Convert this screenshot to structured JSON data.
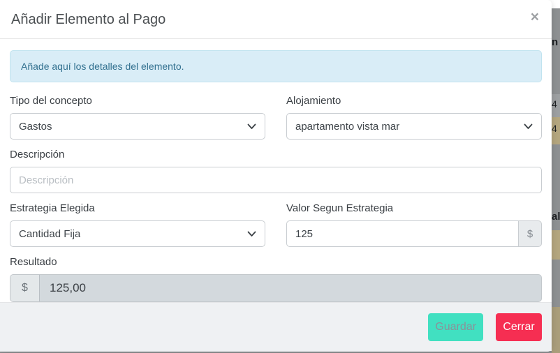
{
  "modal": {
    "title": "Añadir Elemento al Pago",
    "close_icon": "×",
    "alert_text": "Añade aquí los detalles del elemento.",
    "fields": {
      "tipo_concepto": {
        "label": "Tipo del concepto",
        "value": "Gastos"
      },
      "alojamiento": {
        "label": "Alojamiento",
        "value": "apartamento vista mar"
      },
      "descripcion": {
        "label": "Descripción",
        "placeholder": "Descripción",
        "value": ""
      },
      "estrategia": {
        "label": "Estrategia Elegida",
        "value": "Cantidad Fija"
      },
      "valor": {
        "label": "Valor Segun Estrategia",
        "value": "125",
        "addon": "$"
      },
      "resultado": {
        "label": "Resultado",
        "addon": "$",
        "value": "125,00"
      }
    },
    "buttons": {
      "save": "Guardar",
      "close": "Cerrar"
    }
  },
  "colors": {
    "alert_bg": "#d9edf7",
    "alert_text": "#31708f",
    "save_bg": "#41e0c1",
    "save_text": "#8a9299",
    "close_bg": "#f62e52",
    "close_text": "#ffffff"
  },
  "background": {
    "fragments": {
      "f1": "n",
      "f2": "4",
      "f3": "4",
      "f4": "al"
    }
  }
}
